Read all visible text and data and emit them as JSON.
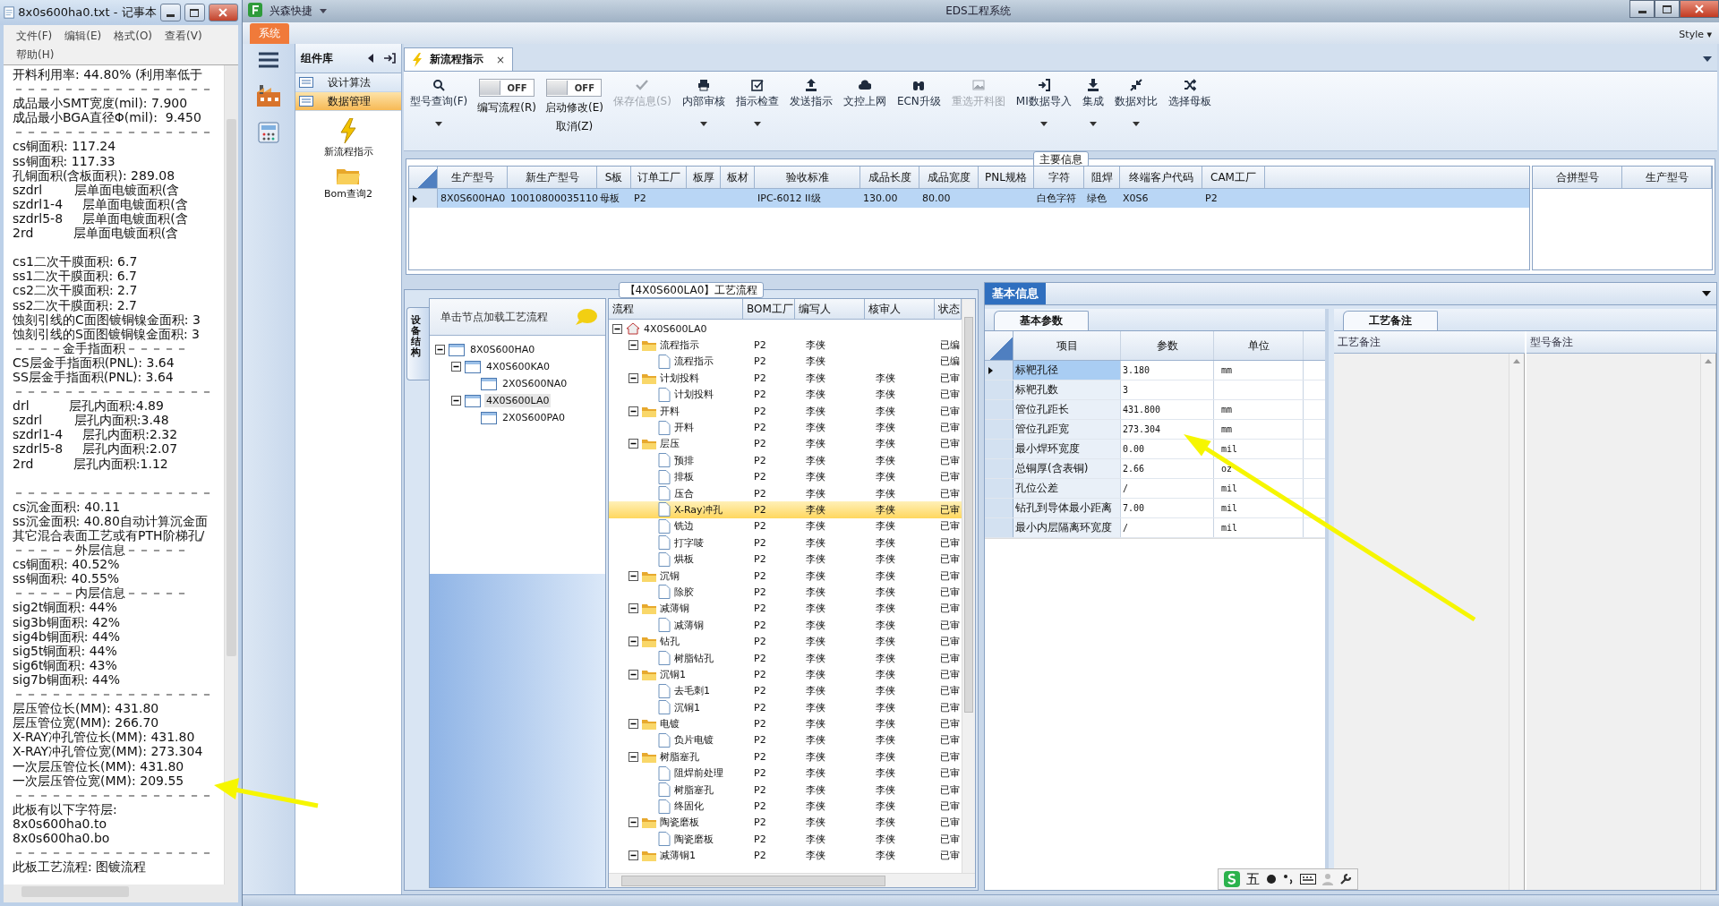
{
  "notepad": {
    "title": "8x0s600ha0.txt - 记事本",
    "menu": [
      "文件(F)",
      "编辑(E)",
      "格式(O)",
      "查看(V)",
      "帮助(H)"
    ],
    "text_blocks": [
      [
        "开料利用率: 44.80% (利用率低于",
        "－－－－－－－－－－－－－－－－",
        "成品最小SMT宽度(mil): 7.900",
        "成品最小BGA直径Φ(mil):  9.450",
        "－－－－－－－－－－－－－－－－",
        "cs铜面积: 117.24",
        "ss铜面积: 117.33",
        "孔铜面积(含板面积): 289.08",
        "szdrl        层单面电镀面积(含",
        "szdrl1-4     层单面电镀面积(含",
        "szdrl5-8     层单面电镀面积(含",
        "2rd          层单面电镀面积(含"
      ],
      [
        "cs1二次干膜面积: 6.7",
        "ss1二次干膜面积: 6.7",
        "cs2二次干膜面积: 2.7",
        "ss2二次干膜面积: 2.7",
        "蚀刻引线的C面图镀铜镍金面积: 3",
        "蚀刻引线的S面图镀铜镍金面积: 3",
        "－－－－金手指面积－－－－－",
        "CS层金手指面积(PNL): 3.64",
        "SS层金手指面积(PNL): 3.64",
        "－－－－－－－－－－－－－－－－",
        "drl          层孔内面积:4.89",
        "szdrl        层孔内面积:3.48",
        "szdrl1-4     层孔内面积:2.32",
        "szdrl5-8     层孔内面积:2.07",
        "2rd          层孔内面积:1.12"
      ],
      [
        "－－－－－－－－－－－－－－－－",
        "cs沉金面积: 40.11",
        "ss沉金面积: 40.80自动计算沉金面",
        "其它混合表面工艺或有PTH阶梯孔/",
        "－－－－－外层信息－－－－－",
        "cs铜面积: 40.52%",
        "ss铜面积: 40.55%",
        "－－－－－内层信息－－－－－",
        "sig2t铜面积: 44%",
        "sig3b铜面积: 42%",
        "sig4b铜面积: 44%",
        "sig5t铜面积: 44%",
        "sig6t铜面积: 43%",
        "sig7b铜面积: 44%",
        "－－－－－－－－－－－－－－－－",
        "层压管位长(MM): 431.80",
        "层压管位宽(MM): 266.70",
        "X-RAY冲孔管位长(MM): 431.80",
        "X-RAY冲孔管位宽(MM): 273.304",
        "一次层压管位长(MM): 431.80",
        "一次层压管位宽(MM): 209.55",
        "－－－－－－－－－－－－－－－－",
        "此板有以下字符层:",
        "8x0s600ha0.to",
        "8x0s600ha0.bo",
        "－－－－－－－－－－－－－－－－",
        "此板工艺流程: 图镀流程"
      ]
    ]
  },
  "app": {
    "quick_title": "兴森快捷",
    "title": "EDS工程系统",
    "ribbon_tabs": [
      {
        "label": "系统",
        "selected": true
      }
    ],
    "style_menu": "Style ▾"
  },
  "sidebar": {
    "title": "组件库",
    "items": [
      {
        "label": "设计算法",
        "selected": false
      },
      {
        "label": "数据管理",
        "selected": true
      }
    ],
    "tools": [
      {
        "label": "新流程指示"
      },
      {
        "label": "Bom查询2"
      }
    ]
  },
  "doc_tabs": [
    {
      "label": "新流程指示",
      "selected": true,
      "close": "×"
    }
  ],
  "toolbar": [
    {
      "kind": "button",
      "label": "型号查询(F)",
      "disabled": false,
      "dropdown": true
    },
    {
      "kind": "toggle",
      "label": "编写流程(R)",
      "switch_text": "OFF",
      "on": false,
      "disabled": false
    },
    {
      "kind": "toggle",
      "label": "启动修改(E)",
      "label2": "取消(Z)",
      "switch_text": "OFF",
      "on": false,
      "disabled": false
    },
    {
      "kind": "button",
      "label": "保存信息(S)",
      "disabled": true,
      "dropdown": false
    },
    {
      "kind": "button",
      "label": "内部审核",
      "disabled": false,
      "dropdown": true
    },
    {
      "kind": "button",
      "label": "指示检查",
      "disabled": false,
      "dropdown": true
    },
    {
      "kind": "button",
      "label": "发送指示",
      "disabled": false,
      "dropdown": false
    },
    {
      "kind": "button",
      "label": "文控上网",
      "disabled": false,
      "dropdown": false
    },
    {
      "kind": "button",
      "label": "ECN升级",
      "disabled": false,
      "dropdown": false
    },
    {
      "kind": "button",
      "label": "重选开料图",
      "disabled": true,
      "dropdown": false
    },
    {
      "kind": "button",
      "label": "MI数据导入",
      "disabled": false,
      "dropdown": true
    },
    {
      "kind": "button",
      "label": "集成",
      "disabled": false,
      "dropdown": true
    },
    {
      "kind": "button",
      "label": "数据对比",
      "disabled": false,
      "dropdown": true
    },
    {
      "kind": "button",
      "label": "选择母板",
      "disabled": false,
      "dropdown": false
    }
  ],
  "main_info": {
    "title": "主要信息",
    "columns": [
      "生产型号",
      "新生产型号",
      "S板",
      "订单工厂",
      "板厚",
      "板材",
      "验收标准",
      "成品长度",
      "成品宽度",
      "PNL规格",
      "字符",
      "阻焊",
      "终端客户代码",
      "CAM工厂"
    ],
    "rows": [
      {
        "selected": true,
        "cells": [
          "8X0S600HA0",
          "10010800035110",
          "母板",
          "P2",
          null,
          null,
          "IPC-6012 II级",
          "130.00",
          "80.00",
          null,
          "白色字符",
          "绿色",
          "X0S6",
          "P2"
        ]
      }
    ],
    "side_columns": [
      "合拼型号",
      "生产型号"
    ]
  },
  "flow": {
    "title": "【4X0S600LA0】工艺流程",
    "side_tab": "设备结构",
    "tree_hint": "单击节点加载工艺流程",
    "tree": [
      {
        "label": "8X0S600HA0",
        "selected": false,
        "expanded": true,
        "children": [
          {
            "label": "4X0S600KA0",
            "selected": false,
            "expanded": true,
            "children": [
              {
                "label": "2X0S600NA0",
                "selected": false
              }
            ]
          },
          {
            "label": "4X0S600LA0",
            "selected": true,
            "expanded": true,
            "children": [
              {
                "label": "2X0S600PA0",
                "selected": false
              }
            ]
          }
        ]
      }
    ],
    "grid": {
      "columns": [
        "流程",
        "BOM工厂",
        "编写人",
        "核审人",
        "状态"
      ],
      "rows": [
        {
          "name": "4X0S600LA0",
          "selected": false,
          "expanded": true,
          "children": [
            {
              "name": "流程指示",
              "bom": "P2",
              "writer": "李侠",
              "status": "已编",
              "selected": false,
              "expanded": true,
              "children": [
                {
                  "name": "流程指示",
                  "bom": "P2",
                  "writer": "李侠",
                  "status": "已编",
                  "selected": false
                }
              ]
            },
            {
              "name": "计划投料",
              "bom": "P2",
              "writer": "李侠",
              "reviewer": "李侠",
              "status": "已审",
              "selected": false,
              "expanded": true,
              "children": [
                {
                  "name": "计划投料",
                  "bom": "P2",
                  "writer": "李侠",
                  "reviewer": "李侠",
                  "status": "已审",
                  "selected": false
                }
              ]
            },
            {
              "name": "开料",
              "bom": "P2",
              "writer": "李侠",
              "reviewer": "李侠",
              "status": "已审",
              "selected": false,
              "expanded": true,
              "children": [
                {
                  "name": "开料",
                  "bom": "P2",
                  "writer": "李侠",
                  "reviewer": "李侠",
                  "status": "已审",
                  "selected": false
                }
              ]
            },
            {
              "name": "层压",
              "bom": "P2",
              "writer": "李侠",
              "reviewer": "李侠",
              "status": "已审",
              "selected": false,
              "expanded": true,
              "children": [
                {
                  "name": "预排",
                  "bom": "P2",
                  "writer": "李侠",
                  "reviewer": "李侠",
                  "status": "已审",
                  "selected": false
                },
                {
                  "name": "排板",
                  "bom": "P2",
                  "writer": "李侠",
                  "reviewer": "李侠",
                  "status": "已审",
                  "selected": false
                },
                {
                  "name": "压合",
                  "bom": "P2",
                  "writer": "李侠",
                  "reviewer": "李侠",
                  "status": "已审",
                  "selected": false
                },
                {
                  "name": "X-Ray冲孔",
                  "bom": "P2",
                  "writer": "李侠",
                  "reviewer": "李侠",
                  "status": "已审",
                  "selected": true
                },
                {
                  "name": "铣边",
                  "bom": "P2",
                  "writer": "李侠",
                  "reviewer": "李侠",
                  "status": "已审",
                  "selected": false
                },
                {
                  "name": "打字唛",
                  "bom": "P2",
                  "writer": "李侠",
                  "reviewer": "李侠",
                  "status": "已审",
                  "selected": false
                },
                {
                  "name": "烘板",
                  "bom": "P2",
                  "writer": "李侠",
                  "reviewer": "李侠",
                  "status": "已审",
                  "selected": false
                }
              ]
            },
            {
              "name": "沉铜",
              "bom": "P2",
              "writer": "李侠",
              "reviewer": "李侠",
              "status": "已审",
              "selected": false,
              "expanded": true,
              "children": [
                {
                  "name": "除胶",
                  "bom": "P2",
                  "writer": "李侠",
                  "reviewer": "李侠",
                  "status": "已审",
                  "selected": false
                }
              ]
            },
            {
              "name": "减薄铜",
              "bom": "P2",
              "writer": "李侠",
              "reviewer": "李侠",
              "status": "已审",
              "selected": false,
              "expanded": true,
              "children": [
                {
                  "name": "减薄铜",
                  "bom": "P2",
                  "writer": "李侠",
                  "reviewer": "李侠",
                  "status": "已审",
                  "selected": false
                }
              ]
            },
            {
              "name": "钻孔",
              "bom": "P2",
              "writer": "李侠",
              "reviewer": "李侠",
              "status": "已审",
              "selected": false,
              "expanded": true,
              "children": [
                {
                  "name": "树脂钻孔",
                  "bom": "P2",
                  "writer": "李侠",
                  "reviewer": "李侠",
                  "status": "已审",
                  "selected": false
                }
              ]
            },
            {
              "name": "沉铜1",
              "bom": "P2",
              "writer": "李侠",
              "reviewer": "李侠",
              "status": "已审",
              "selected": false,
              "expanded": true,
              "children": [
                {
                  "name": "去毛刺1",
                  "bom": "P2",
                  "writer": "李侠",
                  "reviewer": "李侠",
                  "status": "已审",
                  "selected": false
                },
                {
                  "name": "沉铜1",
                  "bom": "P2",
                  "writer": "李侠",
                  "reviewer": "李侠",
                  "status": "已审",
                  "selected": false
                }
              ]
            },
            {
              "name": "电镀",
              "bom": "P2",
              "writer": "李侠",
              "reviewer": "李侠",
              "status": "已审",
              "selected": false,
              "expanded": true,
              "children": [
                {
                  "name": "负片电镀",
                  "bom": "P2",
                  "writer": "李侠",
                  "reviewer": "李侠",
                  "status": "已审",
                  "selected": false
                }
              ]
            },
            {
              "name": "树脂塞孔",
              "bom": "P2",
              "writer": "李侠",
              "reviewer": "李侠",
              "status": "已审",
              "selected": false,
              "expanded": true,
              "children": [
                {
                  "name": "阻焊前处理",
                  "bom": "P2",
                  "writer": "李侠",
                  "reviewer": "李侠",
                  "status": "已审",
                  "selected": false
                },
                {
                  "name": "树脂塞孔",
                  "bom": "P2",
                  "writer": "李侠",
                  "reviewer": "李侠",
                  "status": "已审",
                  "selected": false
                },
                {
                  "name": "终固化",
                  "bom": "P2",
                  "writer": "李侠",
                  "reviewer": "李侠",
                  "status": "已审",
                  "selected": false
                }
              ]
            },
            {
              "name": "陶瓷磨板",
              "bom": "P2",
              "writer": "李侠",
              "reviewer": "李侠",
              "status": "已审",
              "selected": false,
              "expanded": true,
              "children": [
                {
                  "name": "陶瓷磨板",
                  "bom": "P2",
                  "writer": "李侠",
                  "reviewer": "李侠",
                  "status": "已审",
                  "selected": false
                }
              ]
            },
            {
              "name": "减薄铜1",
              "bom": "P2",
              "writer": "李侠",
              "reviewer": "李侠",
              "status": "已审",
              "selected": false,
              "expanded": true
            }
          ]
        }
      ]
    }
  },
  "basic_info": {
    "title": "基本信息",
    "tab": "基本参数",
    "columns": [
      "项目",
      "参数",
      "单位"
    ],
    "rows": [
      {
        "item": "标靶孔径",
        "value": "3.180",
        "unit": "mm",
        "selected": true
      },
      {
        "item": "标靶孔数",
        "value": "3",
        "selected": false
      },
      {
        "item": "管位孔距长",
        "value": "431.800",
        "unit": "mm",
        "selected": false
      },
      {
        "item": "管位孔距宽",
        "value": "273.304",
        "unit": "mm",
        "selected": false
      },
      {
        "item": "最小焊环宽度",
        "value": "0.00",
        "unit": "mil",
        "selected": false
      },
      {
        "item": "总铜厚(含表铜)",
        "value": "2.66",
        "unit": "oz",
        "selected": false
      },
      {
        "item": "孔位公差",
        "value": "/",
        "unit": "mil",
        "selected": false
      },
      {
        "item": "钻孔到导体最小距离",
        "value": "7.00",
        "unit": "mil",
        "selected": false
      },
      {
        "item": "最小内层隔离环宽度",
        "value": "/",
        "unit": "mil",
        "selected": false
      }
    ],
    "notes_tab": "工艺备注",
    "notes_columns": [
      "工艺备注",
      "型号备注"
    ]
  },
  "ime": {
    "label": "五"
  }
}
